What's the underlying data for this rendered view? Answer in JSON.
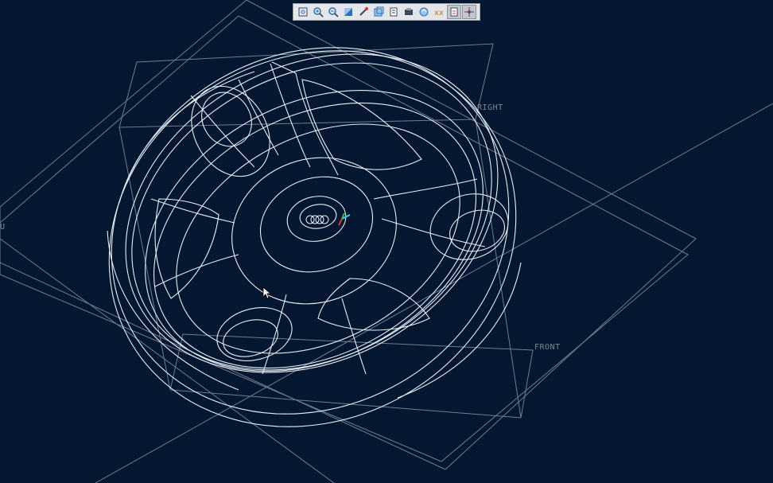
{
  "toolbar": {
    "buttons": [
      {
        "name": "refit-icon",
        "label": "Refit",
        "active": false
      },
      {
        "name": "zoom-in-icon",
        "label": "Zoom In",
        "active": false
      },
      {
        "name": "zoom-out-icon",
        "label": "Zoom Out",
        "active": false
      },
      {
        "name": "repaint-icon",
        "label": "Repaint",
        "active": false
      },
      {
        "name": "reorient-icon",
        "label": "Reorient",
        "active": false
      },
      {
        "name": "saved-views-icon",
        "label": "Saved Views",
        "active": false
      },
      {
        "name": "layers-icon",
        "label": "Layers",
        "active": false
      },
      {
        "name": "display-style-icon",
        "label": "Display Style",
        "active": false
      },
      {
        "name": "view-manager-icon",
        "label": "View Manager",
        "active": false
      },
      {
        "name": "datum-display-icon",
        "label": "Datum Display",
        "active": false
      },
      {
        "name": "annotation-display-icon",
        "label": "Annotation Display",
        "active": true
      },
      {
        "name": "spin-center-icon",
        "label": "Spin Center",
        "active": true
      }
    ]
  },
  "planes": {
    "right_label": "RIGHT",
    "front_label": "FRONT",
    "top_label": "U"
  },
  "colors": {
    "background": "#041630",
    "wireframe": "#e8eef5",
    "datum_plane": "#6f7d8e"
  },
  "model": {
    "display_style": "wireframe",
    "part": "wheel rim",
    "emblem": "four-rings-emblem"
  }
}
